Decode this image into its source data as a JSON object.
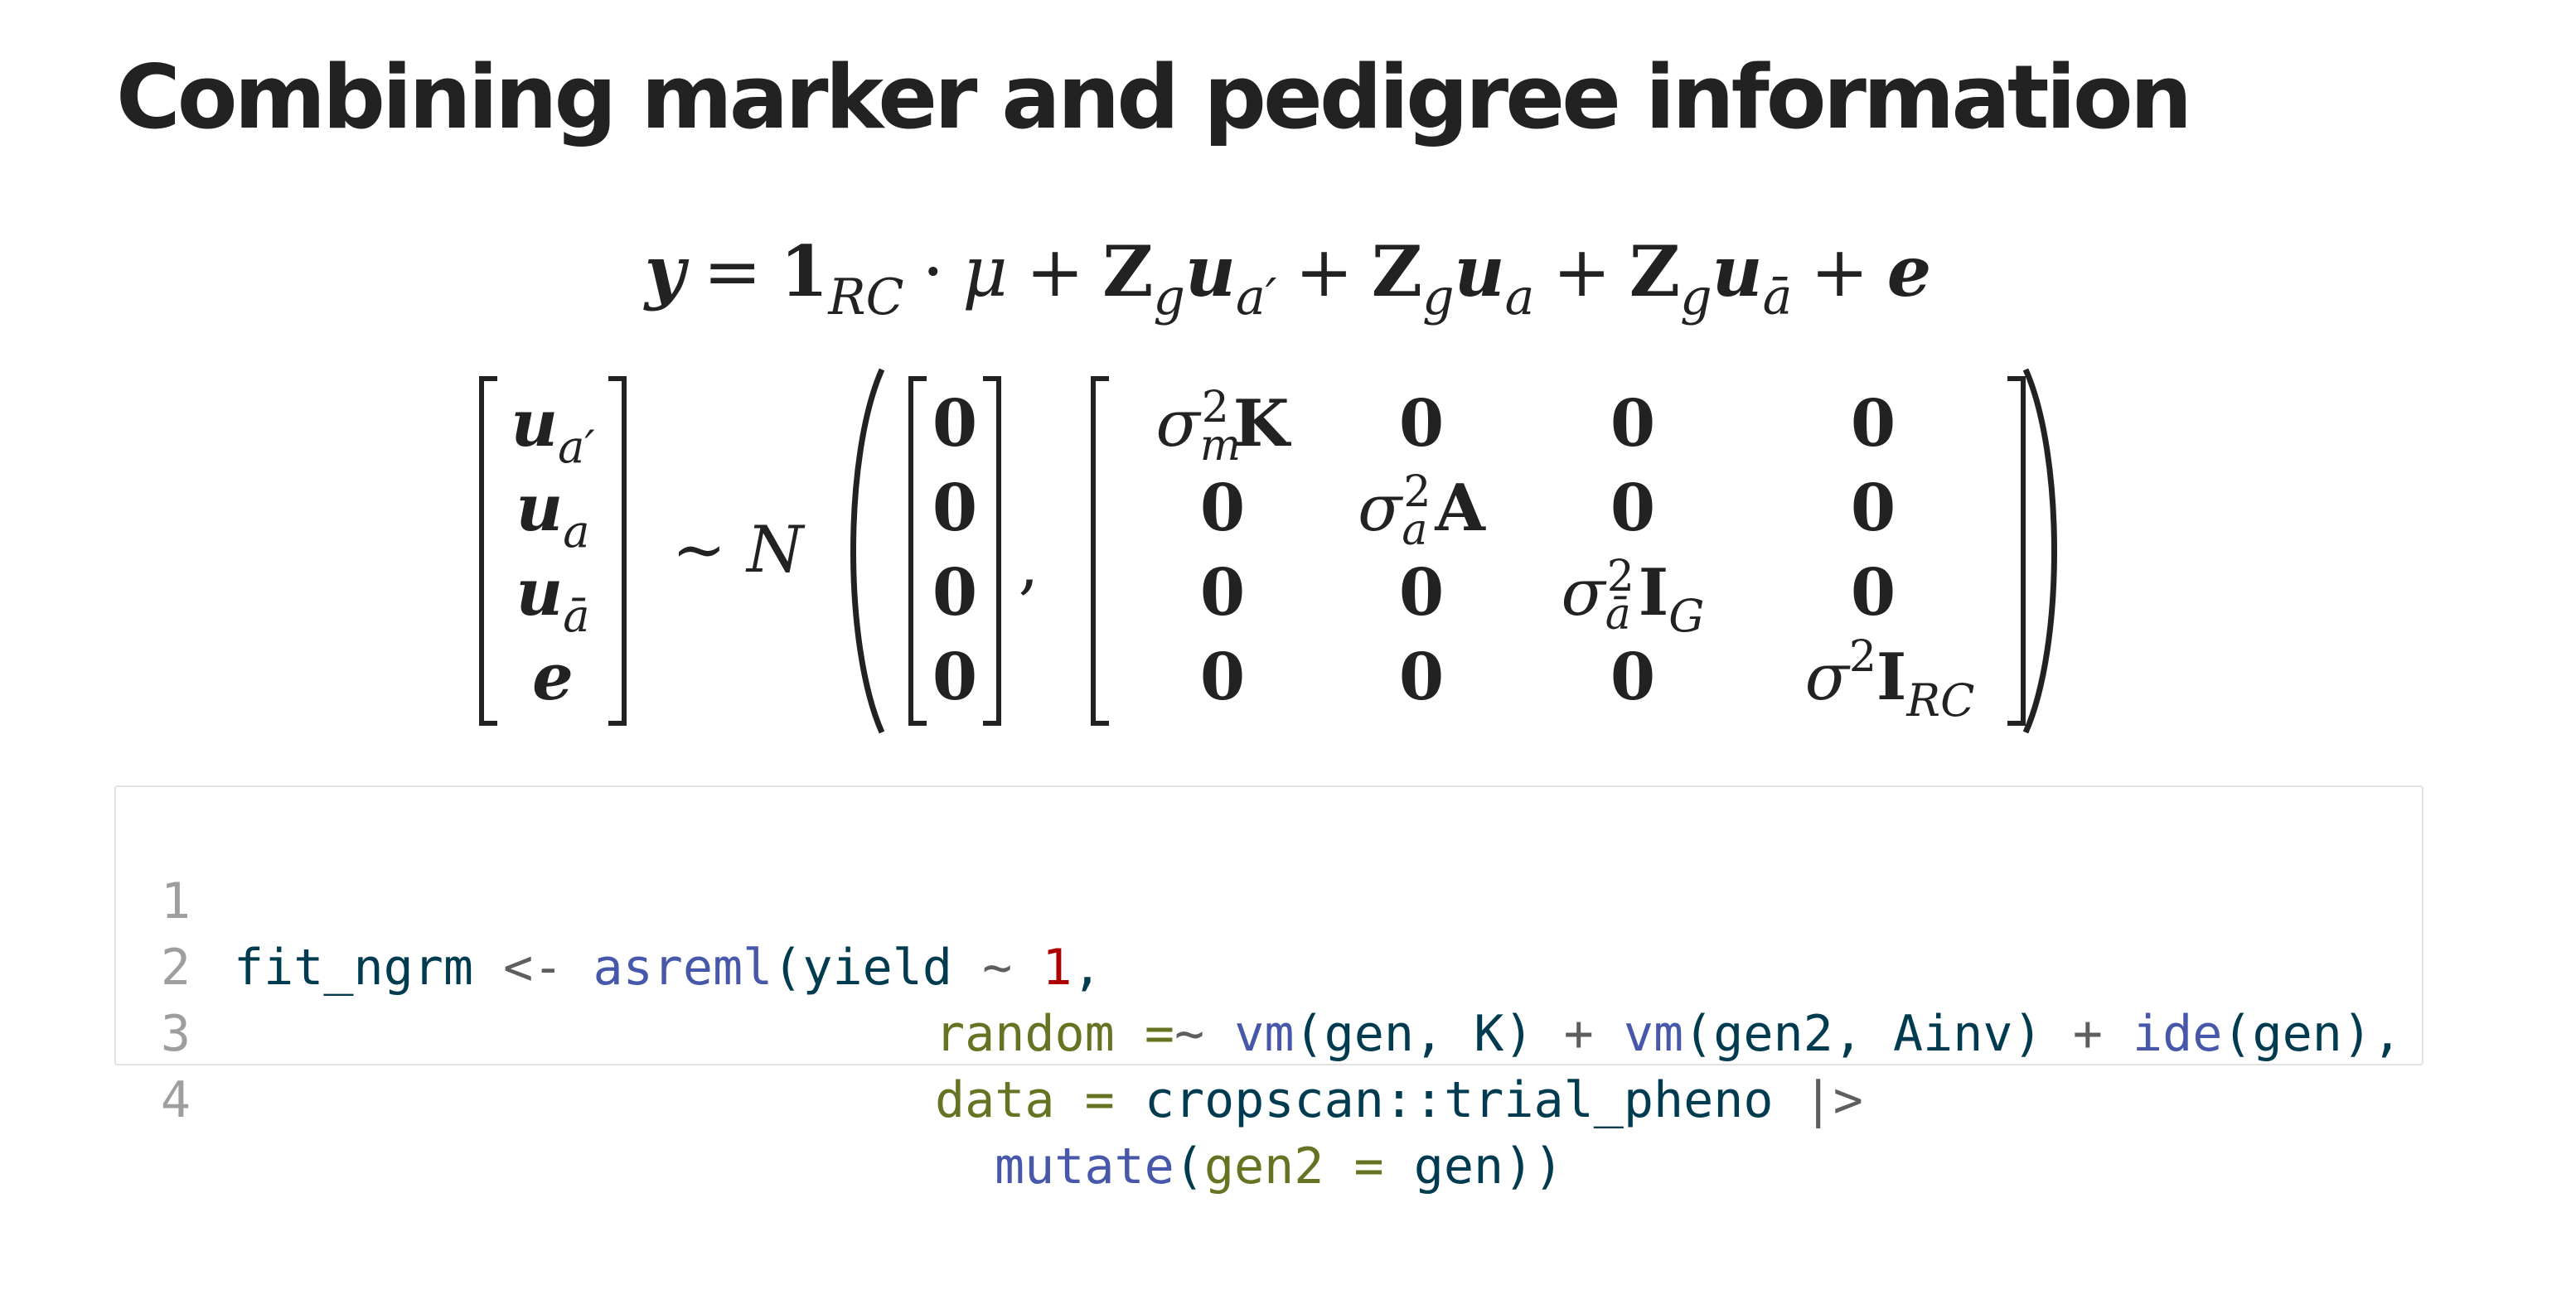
{
  "title": "Combining marker and pedigree information",
  "equation_model": {
    "lhs": "y",
    "eq": "=",
    "one": "1",
    "rc": "RC",
    "dot": "·",
    "mu": "μ",
    "plus": "+",
    "Z": "Z",
    "g": "g",
    "u": "u",
    "sub_a_prime": "a′",
    "sub_a": "a",
    "sub_a_bar": "ā",
    "e": "e"
  },
  "equation_distribution": {
    "vector": [
      "u",
      "u",
      "u",
      "e"
    ],
    "vector_subs": [
      "a′",
      "a",
      "ā",
      ""
    ],
    "tilde_N": "∼ N",
    "N": "N",
    "comma": ",",
    "zero_mean": [
      "0",
      "0",
      "0",
      "0"
    ],
    "matrix": {
      "r1": {
        "sigma": "σ",
        "sup": "2",
        "sub": "m",
        "mat": "K",
        "c2": "0",
        "c3": "0",
        "c4": "0"
      },
      "r2": {
        "c1": "0",
        "sigma": "σ",
        "sup": "2",
        "sub": "a",
        "mat": "A",
        "c3": "0",
        "c4": "0"
      },
      "r3": {
        "c1": "0",
        "c2": "0",
        "sigma": "σ",
        "sup": "2",
        "sub": "ā",
        "mat": "I",
        "mat_sub": "G",
        "c4": "0"
      },
      "r4": {
        "c1": "0",
        "c2": "0",
        "c3": "0",
        "sigma": "σ",
        "sup": "2",
        "mat": "I",
        "mat_sub": "RC"
      }
    }
  },
  "code": {
    "line_numbers": [
      "1",
      "2",
      "3",
      "4"
    ],
    "line1": {
      "obj": "fit_ngrm",
      "assign": " <- ",
      "fn": "asreml",
      "open": "(",
      "resp": "yield",
      "tilde": " ~ ",
      "num": "1",
      "comma": ","
    },
    "line2": {
      "arg": "random =",
      "tilde": "~",
      "fn1": "vm",
      "args1": "(gen, K)",
      "plus1": " + ",
      "fn2": "vm",
      "args2": "(gen2, Ainv)",
      "plus2": " + ",
      "fn3": "ide",
      "args3": "(gen),"
    },
    "line3": {
      "arg": "data = ",
      "pkg": "cropscan::trial_pheno",
      "pipe": " |>"
    },
    "line4": {
      "fn": "mutate",
      "open": "(",
      "arg": "gen2 = ",
      "val": "gen",
      "close": "))"
    }
  },
  "colors": {
    "text": "#222222",
    "code_identifier": "#003b4f",
    "code_function": "#4758ab",
    "code_number": "#ad0000",
    "code_argument": "#657422",
    "code_operator": "#5e5e5e",
    "line_number": "#9e9e9e",
    "code_border": "#e2e2e2"
  }
}
